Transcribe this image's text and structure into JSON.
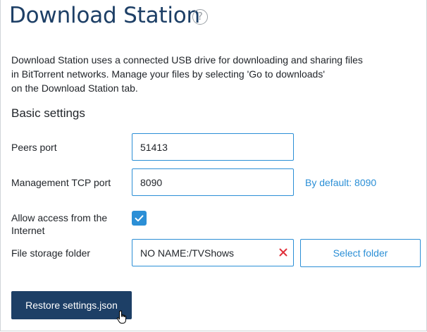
{
  "page": {
    "title": "Download Station",
    "help_icon": "question-circle-icon"
  },
  "description": [
    "Download Station uses a connected USB drive for downloading and sharing files",
    "in BitTorrent networks. Manage your files by selecting 'Go to downloads'",
    "on the Download Station tab."
  ],
  "basic_settings": {
    "title": "Basic settings",
    "peers_port": {
      "label": "Peers port",
      "value": "51413"
    },
    "management_tcp_port": {
      "label": "Management TCP port",
      "value": "8090",
      "hint": "By default: 8090"
    },
    "allow_internet": {
      "label_line1": "Allow access from the",
      "label_line2": "Internet",
      "checked": true
    },
    "storage_folder": {
      "label": "File storage folder",
      "value": "NO NAME:/TVShows",
      "clear_icon": "clear-x-icon",
      "select_button": "Select folder"
    }
  },
  "actions": {
    "restore_button": "Restore settings.json",
    "cursor_icon": "hand-pointer-icon"
  },
  "colors": {
    "accent": "#2b8fd6",
    "title": "#1d3f66",
    "primary_button": "#1d3f66",
    "clear_icon": "#e0303a"
  }
}
